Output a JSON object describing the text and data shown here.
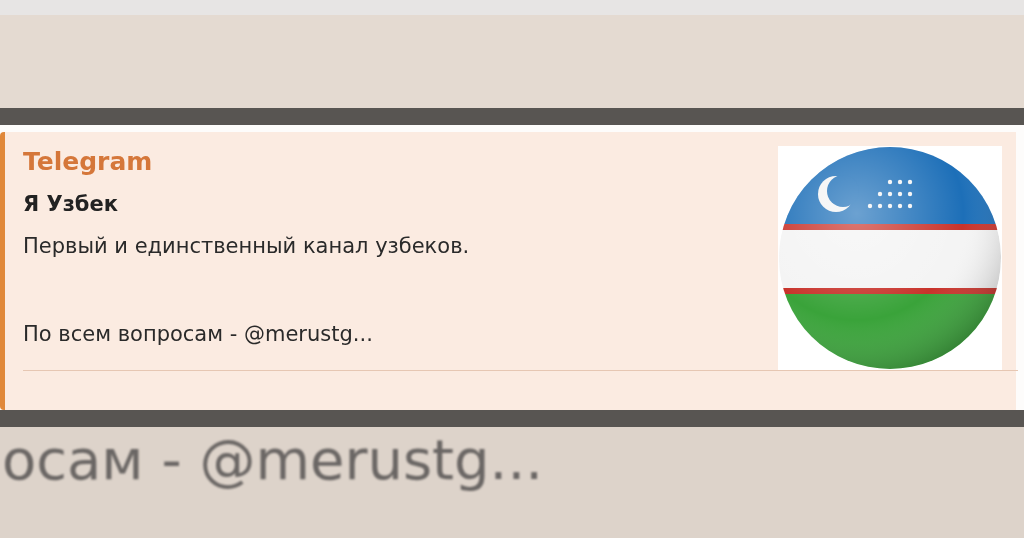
{
  "preview": {
    "site_name": "Telegram",
    "title": "Я Узбек",
    "description": "Первый и единственный канал узбеков.\n\nПо всем вопросам - @merustg..."
  },
  "background_text": "осам - @merustg..."
}
